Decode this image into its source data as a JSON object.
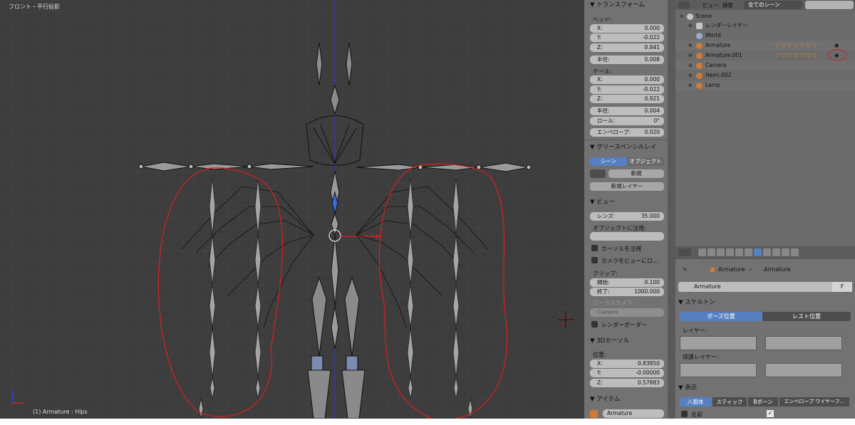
{
  "viewport": {
    "title": "フロント・平行投影",
    "status": "(1) Armature : Hips"
  },
  "npanel": {
    "transform_header": "▼ トランスフォーム",
    "head_label": "ヘッド:",
    "head_x_label": "X:",
    "head_x": "0.000",
    "head_y_label": "Y:",
    "head_y": "-0.022",
    "head_z_label": "Z:",
    "head_z": "0.841",
    "head_radius_label": "半径:",
    "head_radius": "0.008",
    "tail_label": "テール:",
    "tail_x_label": "X:",
    "tail_x": "0.000",
    "tail_y_label": "Y:",
    "tail_y": "-0.022",
    "tail_z_label": "Z:",
    "tail_z": "0.921",
    "tail_radius_label": "半径:",
    "tail_radius": "0.004",
    "roll_label": "ロール:",
    "roll": "0°",
    "envelope_label": "エンベロープ:",
    "envelope": "0.020",
    "grease_header": "▼ グリースペンシルレイ",
    "scene_btn": "シーン",
    "object_btn": "オブジェクト",
    "new_btn": "新規",
    "new_layer_btn": "新規レイヤー",
    "view_header": "▼ ビュー",
    "lens_label": "レンズ:",
    "lens": "35.000",
    "lock_label": "オブジェクトに注視:",
    "lock_cursor": "カーソルを注視",
    "lock_camera": "カメラをビューにロ…",
    "clip_label": "クリップ:",
    "clip_start_label": "開始:",
    "clip_start": "0.100",
    "clip_end_label": "終了:",
    "clip_end": "1000.000",
    "local_camera": "ローカルカメラ:",
    "camera_field": "Camera",
    "render_border": "レンダーボーダー",
    "cursor_header": "▼ 3Dカーソル",
    "location_label": "位置:",
    "cur_x_label": "X:",
    "cur_x": "0.83850",
    "cur_y_label": "Y:",
    "cur_y": "-0.00000",
    "cur_z_label": "Z:",
    "cur_z": "0.57883",
    "item_header": "▼ アイテム",
    "item_name": "Armature"
  },
  "outliner": {
    "view_menu": "ビュー",
    "search_menu": "検索",
    "scene_dropdown": "全てのシーン",
    "rows": [
      {
        "name": "Scene"
      },
      {
        "name": "レンダーレイヤー"
      },
      {
        "name": "World"
      },
      {
        "name": "Armature"
      },
      {
        "name": "Armature.001"
      },
      {
        "name": "Camera"
      },
      {
        "name": "Hemi.002"
      },
      {
        "name": "Lamp"
      }
    ]
  },
  "props": {
    "crumb1": "Armature",
    "crumb2": "Armature",
    "name_value": "Armature",
    "f_label": "F",
    "skeleton_header": "▼ スケルトン",
    "pose_position": "ポーズ位置",
    "rest_position": "レスト位置",
    "layers_label": "レイヤー:",
    "protected_layers_label": "保護レイヤー:",
    "display_header": "▼ 表示",
    "display_opts": [
      "八面体",
      "スティック",
      "Bボーン",
      "エンベロープ",
      "ワイヤーフ…"
    ],
    "names_label": "名前"
  },
  "colors": {
    "accent": "#5680c2",
    "annotation": "#d42020",
    "viewport_bg": "#3d3d3d"
  }
}
